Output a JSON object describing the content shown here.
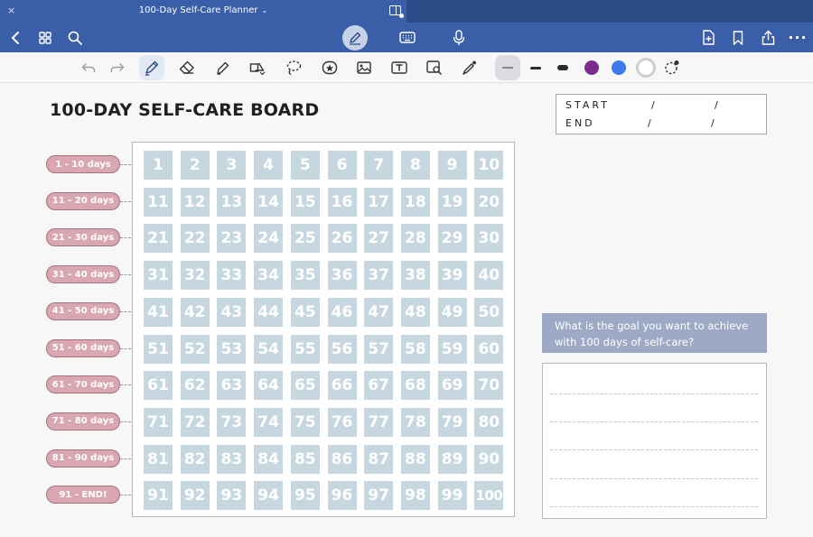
{
  "tab": {
    "close": "×",
    "title": "100-Day Self-Care Planner",
    "chevron": "⌄"
  },
  "appbar": {
    "icons": [
      "chevron-left-icon",
      "grid-icon",
      "search-icon",
      "pen-mode-icon",
      "keyboard-icon",
      "microphone-icon",
      "add-page-icon",
      "bookmark-icon",
      "share-icon",
      "more-icon"
    ],
    "more": "···"
  },
  "toolbar": {
    "icons": [
      "undo-icon",
      "redo-icon",
      "pen-icon",
      "eraser-icon",
      "highlighter-icon",
      "shapes-icon",
      "lasso-icon",
      "sticker-icon",
      "image-icon",
      "text-icon",
      "image-search-icon",
      "laser-pointer-icon"
    ],
    "pen_colors": [
      "#2b2b2b",
      "#7b2d8e",
      "#3b7ae8",
      "#ffffff"
    ]
  },
  "board": {
    "title": "100-DAY SELF-CARE BOARD",
    "start_label": "START",
    "end_label": "END",
    "date_separator": "/",
    "ranges": [
      "1 - 10 days",
      "11 - 20 days",
      "21 - 30 days",
      "31 - 40 days",
      "41 - 50 days",
      "51 - 60 days",
      "61 - 70 days",
      "71 - 80 days",
      "81 - 90 days",
      "91 - END!"
    ],
    "days": [
      "1",
      "2",
      "3",
      "4",
      "5",
      "6",
      "7",
      "8",
      "9",
      "10",
      "11",
      "12",
      "13",
      "14",
      "15",
      "16",
      "17",
      "18",
      "19",
      "20",
      "21",
      "22",
      "23",
      "24",
      "25",
      "26",
      "27",
      "28",
      "29",
      "30",
      "31",
      "32",
      "33",
      "34",
      "35",
      "36",
      "37",
      "38",
      "39",
      "40",
      "41",
      "42",
      "43",
      "44",
      "45",
      "46",
      "47",
      "48",
      "49",
      "50",
      "51",
      "52",
      "53",
      "54",
      "55",
      "56",
      "57",
      "58",
      "59",
      "60",
      "61",
      "62",
      "63",
      "64",
      "65",
      "66",
      "67",
      "68",
      "69",
      "70",
      "71",
      "72",
      "73",
      "74",
      "75",
      "76",
      "77",
      "78",
      "79",
      "80",
      "81",
      "82",
      "83",
      "84",
      "85",
      "86",
      "87",
      "88",
      "89",
      "90",
      "91",
      "92",
      "93",
      "94",
      "95",
      "96",
      "97",
      "98",
      "99",
      "100"
    ]
  },
  "goal": {
    "question": "What is the goal you want to achieve with 100 days of self-care?"
  },
  "colors": {
    "header": "#3a5ea8",
    "cell": "#c6d7e0",
    "pill": "#d8a7b1",
    "goal_header": "#9eaac5"
  }
}
